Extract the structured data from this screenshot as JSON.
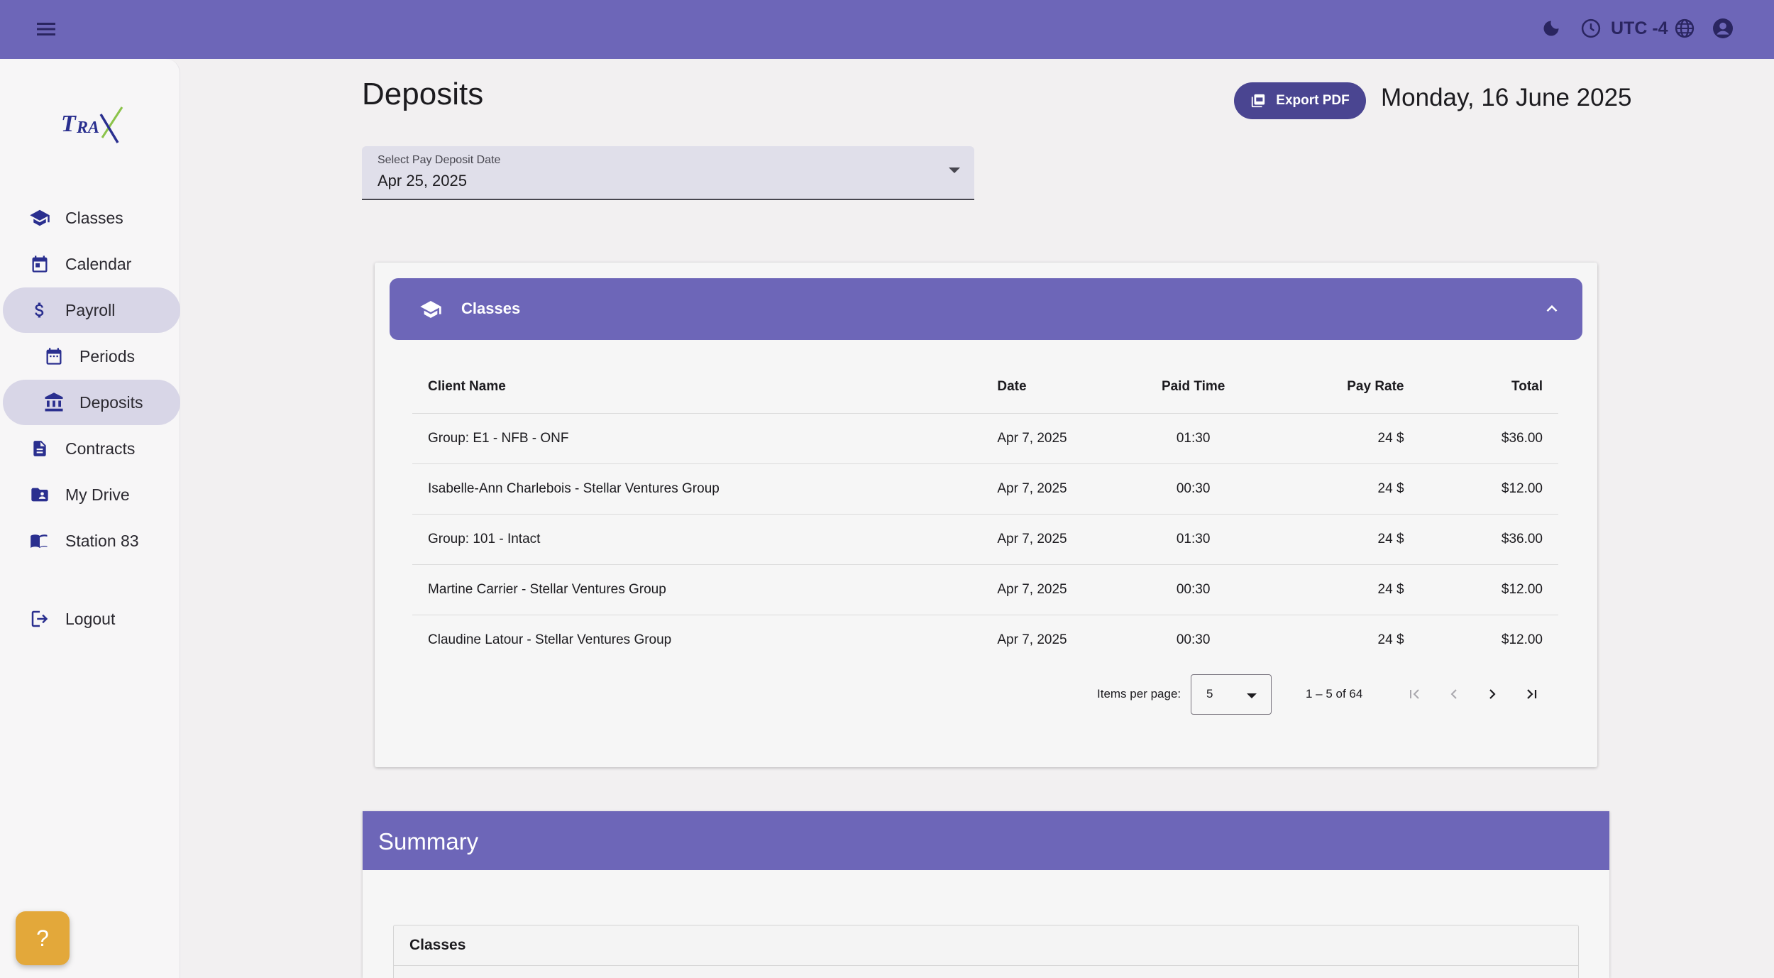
{
  "topbar": {
    "timezone_label": "UTC -4"
  },
  "sidebar": {
    "logo_text": "TRAX",
    "items": [
      {
        "label": "Classes",
        "icon": "school-icon"
      },
      {
        "label": "Calendar",
        "icon": "calendar-icon"
      },
      {
        "label": "Payroll",
        "icon": "dollar-icon"
      },
      {
        "label": "Periods",
        "icon": "calendar-icon"
      },
      {
        "label": "Deposits",
        "icon": "bank-icon"
      },
      {
        "label": "Contracts",
        "icon": "document-icon"
      },
      {
        "label": "My Drive",
        "icon": "folder-shared-icon"
      },
      {
        "label": "Station 83",
        "icon": "book-icon"
      },
      {
        "label": "Logout",
        "icon": "logout-icon"
      }
    ],
    "help_label": "?"
  },
  "page": {
    "title": "Deposits",
    "export_label": "Export PDF",
    "today": "Monday, 16 June 2025"
  },
  "deposit_date": {
    "label": "Select Pay Deposit Date",
    "value": "Apr 25, 2025"
  },
  "classes_panel": {
    "title": "Classes",
    "columns": [
      "Client Name",
      "Date",
      "Paid Time",
      "Pay Rate",
      "Total"
    ],
    "rows": [
      [
        "Group: E1 - NFB - ONF",
        "Apr 7, 2025",
        "01:30",
        "24 $",
        "$36.00"
      ],
      [
        "Isabelle-Ann Charlebois - Stellar Ventures Group",
        "Apr 7, 2025",
        "00:30",
        "24 $",
        "$12.00"
      ],
      [
        "Group: 101 - Intact",
        "Apr 7, 2025",
        "01:30",
        "24 $",
        "$36.00"
      ],
      [
        "Martine Carrier - Stellar Ventures Group",
        "Apr 7, 2025",
        "00:30",
        "24 $",
        "$12.00"
      ],
      [
        "Claudine Latour - Stellar Ventures Group",
        "Apr 7, 2025",
        "00:30",
        "24 $",
        "$12.00"
      ]
    ],
    "pager": {
      "items_label": "Items per page:",
      "page_size": "5",
      "range": "1 – 5 of 64"
    }
  },
  "summary": {
    "title": "Summary",
    "classes_title": "Classes"
  },
  "colors": {
    "primary": "#6d66b8",
    "primary_dark": "#4a4591",
    "nav_active": "#d8d6e7",
    "help": "#e3a83a"
  }
}
